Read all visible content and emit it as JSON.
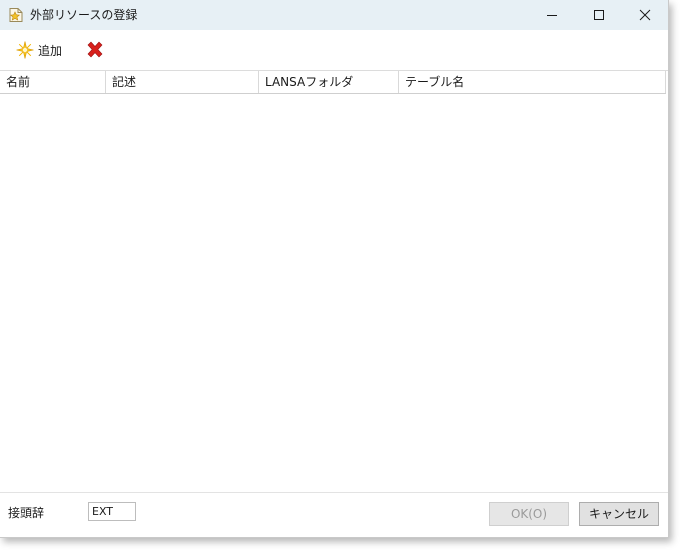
{
  "window": {
    "title": "外部リソースの登録",
    "app_icon": "star-document-icon",
    "controls": {
      "minimize": "minimize-icon",
      "maximize": "maximize-icon",
      "close": "close-icon"
    }
  },
  "toolbar": {
    "add_label": "追加",
    "add_icon": "sparkle-add-icon",
    "delete_icon": "red-x-delete-icon",
    "delete_color": "#d8201c"
  },
  "grid": {
    "columns": [
      "名前",
      "記述",
      "LANSAフォルダ",
      "テーブル名"
    ],
    "rows": []
  },
  "footer": {
    "prefix_label": "接頭辞",
    "prefix_value": "EXT",
    "ok_label": "OK(O)",
    "ok_enabled": false,
    "cancel_label": "キャンセル"
  },
  "colors": {
    "titlebar_bg": "#e7f0f5",
    "window_bg": "#ffffff",
    "border": "#cfcfcf"
  }
}
